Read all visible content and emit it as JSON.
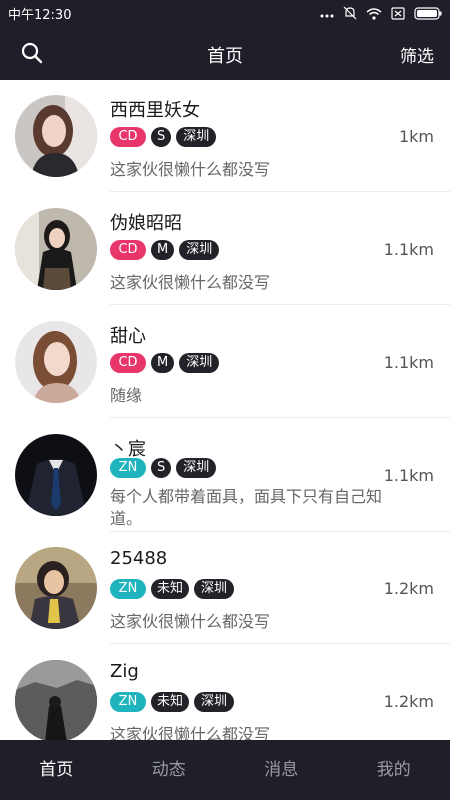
{
  "status_bar": {
    "time": "中午12:30"
  },
  "nav": {
    "title": "首页",
    "filter_label": "筛选"
  },
  "users": [
    {
      "name": "西西里妖女",
      "tag": "CD",
      "size": "S",
      "city": "深圳",
      "distance": "1km",
      "signature": "这家伙很懒什么都没写"
    },
    {
      "name": "伪娘昭昭",
      "tag": "CD",
      "size": "M",
      "city": "深圳",
      "distance": "1.1km",
      "signature": "这家伙很懒什么都没写"
    },
    {
      "name": "甜心",
      "tag": "CD",
      "size": "M",
      "city": "深圳",
      "distance": "1.1km",
      "signature": "随缘"
    },
    {
      "name": "丶宸",
      "tag": "ZN",
      "size": "S",
      "city": "深圳",
      "distance": "1.1km",
      "signature": "每个人都带着面具，面具下只有自己知道。"
    },
    {
      "name": "25488",
      "tag": "ZN",
      "size": "未知",
      "city": "深圳",
      "distance": "1.2km",
      "signature": "这家伙很懒什么都没写"
    },
    {
      "name": "Zig",
      "tag": "ZN",
      "size": "未知",
      "city": "深圳",
      "distance": "1.2km",
      "signature": "这家伙很懒什么都没写"
    }
  ],
  "tabs": [
    {
      "label": "首页",
      "active": true
    },
    {
      "label": "动态",
      "active": false
    },
    {
      "label": "消息",
      "active": false
    },
    {
      "label": "我的",
      "active": false
    }
  ],
  "colors": {
    "bar_bg": "#1e1f29",
    "tag_cd": "#e8356a",
    "tag_zn": "#1eb3bd",
    "tag_dark": "#222328"
  }
}
